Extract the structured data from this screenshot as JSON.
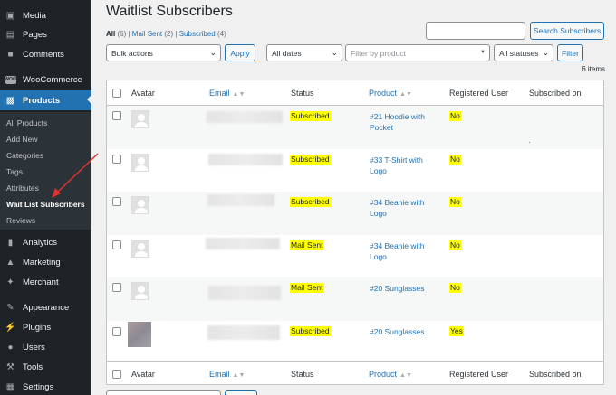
{
  "sidebar": {
    "top_items": [
      {
        "label": "Media",
        "icon": "media-icon"
      },
      {
        "label": "Pages",
        "icon": "pages-icon"
      },
      {
        "label": "Comments",
        "icon": "comments-icon"
      },
      {
        "label": "WooCommerce",
        "icon": "woocommerce-icon"
      },
      {
        "label": "Products",
        "icon": "products-icon"
      }
    ],
    "submenu": [
      "All Products",
      "Add New",
      "Categories",
      "Tags",
      "Attributes",
      "Wait List Subscribers",
      "Reviews"
    ],
    "bottom_items": [
      {
        "label": "Analytics",
        "icon": "analytics-icon"
      },
      {
        "label": "Marketing",
        "icon": "marketing-icon"
      },
      {
        "label": "Merchant",
        "icon": "merchant-icon"
      },
      {
        "label": "Appearance",
        "icon": "appearance-icon"
      },
      {
        "label": "Plugins",
        "icon": "plugins-icon"
      },
      {
        "label": "Users",
        "icon": "users-icon"
      },
      {
        "label": "Tools",
        "icon": "tools-icon"
      },
      {
        "label": "Settings",
        "icon": "settings-icon"
      }
    ],
    "woo_badge": "WOO"
  },
  "page": {
    "title": "Waitlist Subscribers",
    "views": {
      "all_label": "All",
      "all_count": "(6)",
      "sep": "|",
      "mail_sent_label": "Mail Sent",
      "mail_sent_count": "(2)",
      "subscribed_label": "Subscribed",
      "subscribed_count": "(4)"
    },
    "search_button": "Search Subscribers",
    "bulk_actions": "Bulk actions",
    "apply": "Apply",
    "all_dates": "All dates",
    "filter_by_product": "Filter by product",
    "all_statuses": "All statuses",
    "filter": "Filter",
    "items_count": "6 items"
  },
  "table": {
    "columns": {
      "avatar": "Avatar",
      "email": "Email",
      "status": "Status",
      "product": "Product",
      "registered": "Registered User",
      "subscribed_on": "Subscribed on"
    },
    "rows": [
      {
        "status": "Subscribed",
        "product_line1": "#21 Hoodie with",
        "product_line2": "Pocket",
        "registered": "No"
      },
      {
        "status": "Subscribed",
        "product_line1": "#33 T-Shirt with",
        "product_line2": "Logo",
        "registered": "No"
      },
      {
        "status": "Subscribed",
        "product_line1": "#34 Beanie with",
        "product_line2": "Logo",
        "registered": "No"
      },
      {
        "status": "Mail Sent",
        "product_line1": "#34 Beanie with",
        "product_line2": "Logo",
        "registered": "No"
      },
      {
        "status": "Mail Sent",
        "product_line1": "#20 Sunglasses",
        "product_line2": "",
        "registered": "No"
      },
      {
        "status": "Subscribed",
        "product_line1": "#20 Sunglasses",
        "product_line2": "",
        "registered": "Yes"
      }
    ]
  },
  "colors": {
    "sidebar_bg": "#1d2327",
    "accent": "#2271b1",
    "highlight": "#ffff00",
    "annotation_arrow": "#e0322f"
  }
}
